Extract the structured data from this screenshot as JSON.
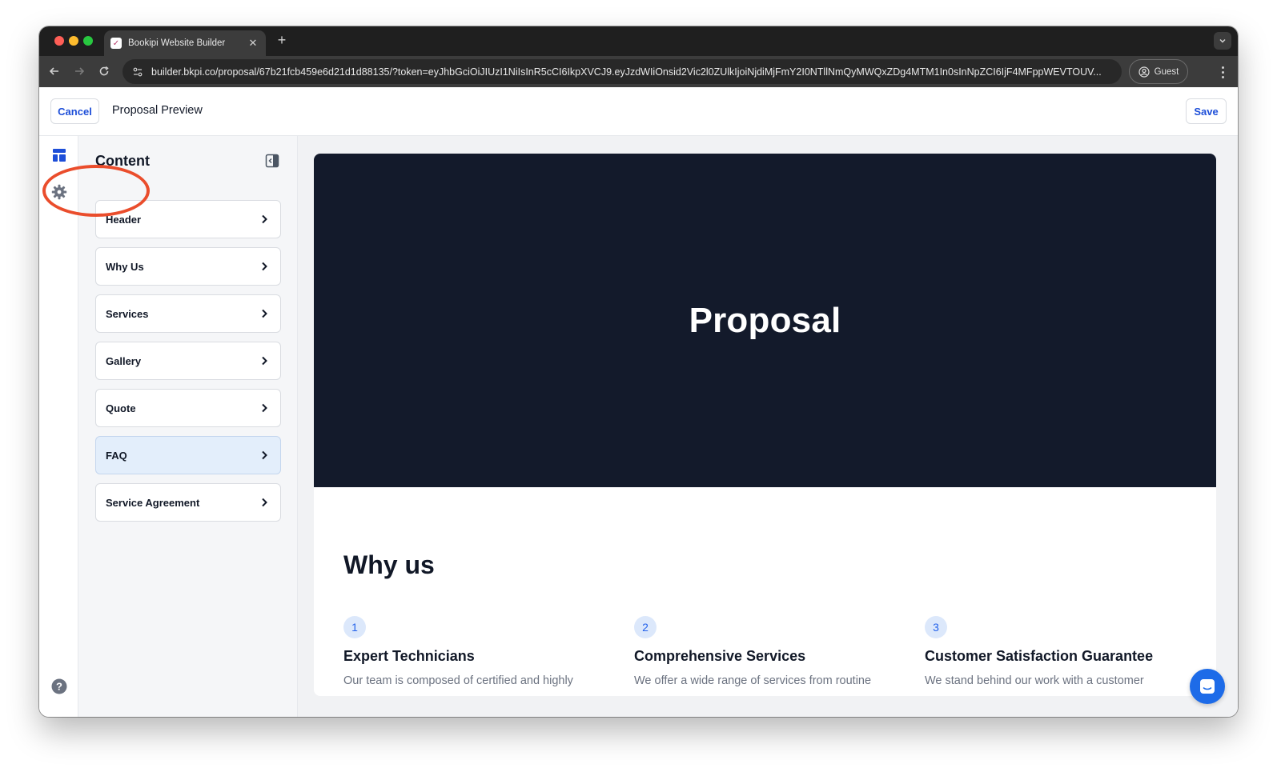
{
  "browser": {
    "tab_title": "Bookipi Website Builder",
    "url": "builder.bkpi.co/proposal/67b21fcb459e6d21d1d88135/?token=eyJhbGciOiJIUzI1NiIsInR5cCI6IkpXVCJ9.eyJzdWIiOnsid2Vic2l0ZUlkIjoiNjdiMjFmY2I0NTllNmQyMWQxZDg4MTM1In0sInNpZCI6IjF4MFppWEVTOUV...",
    "profile_label": "Guest"
  },
  "header": {
    "cancel_label": "Cancel",
    "title": "Proposal Preview",
    "save_label": "Save"
  },
  "sidebar": {
    "title": "Content",
    "items": [
      {
        "label": "Header"
      },
      {
        "label": "Why Us"
      },
      {
        "label": "Services"
      },
      {
        "label": "Gallery"
      },
      {
        "label": "Quote"
      },
      {
        "label": "FAQ",
        "active": true
      },
      {
        "label": "Service Agreement"
      }
    ]
  },
  "preview": {
    "hero_title": "Proposal",
    "why_title": "Why us",
    "features": [
      {
        "num": "1",
        "title": "Expert Technicians",
        "desc": "Our team is composed of certified and highly"
      },
      {
        "num": "2",
        "title": "Comprehensive Services",
        "desc": "We offer a wide range of services from routine"
      },
      {
        "num": "3",
        "title": "Customer Satisfaction Guarantee",
        "desc": "We stand behind our work with a customer"
      }
    ]
  },
  "colors": {
    "accent": "#1d4ed8",
    "hero_bg": "#131a2b",
    "annotation": "#ea4d2c",
    "active_item_bg": "#e3eefb"
  }
}
